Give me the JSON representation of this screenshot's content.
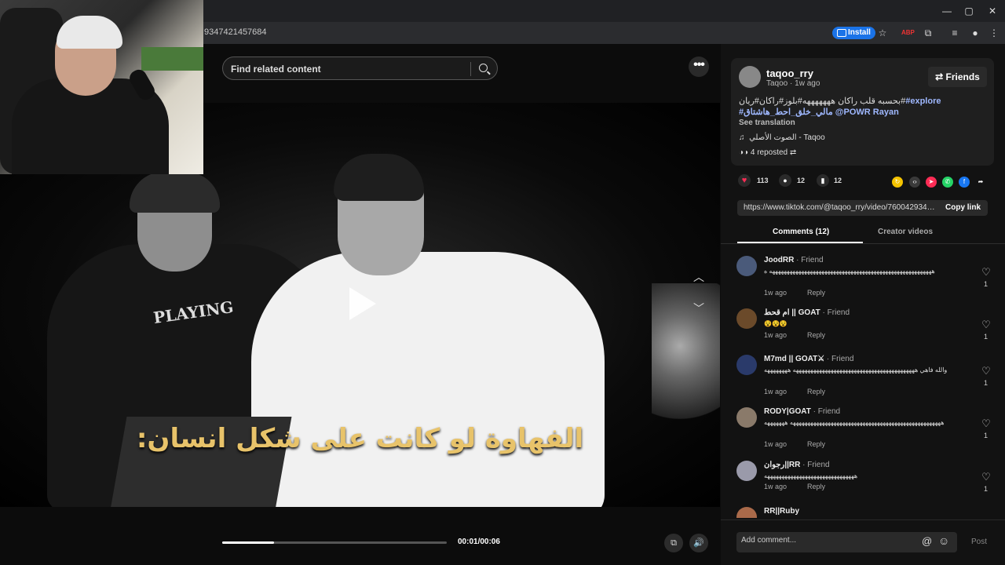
{
  "browser": {
    "url": "9347421457684",
    "install_label": "Install",
    "window_controls": [
      "—",
      "▢",
      "✕"
    ]
  },
  "search": {
    "placeholder": "Find related content"
  },
  "video": {
    "caption": "الفهاوة لو كانت على شكل انسان:",
    "shirt_text": "PLAYING",
    "time": "00:01/00:06",
    "progress_fraction": 0.23
  },
  "post": {
    "username": "taqoo_rry",
    "subline": "Taqoo · 1w ago",
    "friends_label": "Friends",
    "description_ar": "بحسبه قلب راكان هههههههه#بلوز#راكان#ريان#",
    "tag_explore": "#explore",
    "desc_line2_ar": "#مالي_خلق_احط_هاشتاق",
    "mention": "@POWR Rayan",
    "see_translation": "See translation",
    "music": "الصوت الأصلي - Taqoo",
    "reposted": "4 reposted",
    "likes": "113",
    "comments_count": "12",
    "saves": "12",
    "link": "https://www.tiktok.com/@taqoo_rry/video/7600429347...",
    "copy_link": "Copy link"
  },
  "tabs": {
    "comments": "Comments (12)",
    "creator": "Creator videos"
  },
  "comments": [
    {
      "name": "JoodRR",
      "tag": " · Friend",
      "text": "ههههههههههههههههههههههههههههههههههههههههههههههههههههههههه ه",
      "time": "1w ago",
      "reply": "Reply",
      "likes": "1"
    },
    {
      "name": "ام قحط || GOAT",
      "tag": " · Friend",
      "text": "😵😵😵",
      "time": "1w ago",
      "reply": "Reply",
      "likes": "1"
    },
    {
      "name": "M7md || GOAT⚔",
      "tag": " · Friend",
      "text": "والله فاهي ههههههههههههههههههههههههههههههههههههههههههه ههههههههه",
      "time": "1w ago",
      "reply": "Reply",
      "likes": "1"
    },
    {
      "name": "RODY|GOAT",
      "tag": " · Friend",
      "text": "ههههههههههههههههههههههههههههههههههههههههههههههههههههه هههههههه",
      "time": "1w ago",
      "reply": "Reply",
      "likes": "1"
    },
    {
      "name": "رجوان||RR",
      "tag": " · Friend",
      "text": "هههههههههههههههههههههههههههههههه",
      "time": "1w ago",
      "reply": "Reply",
      "likes": "1"
    },
    {
      "name": "RR||Ruby",
      "tag": "",
      "text": "",
      "time": "",
      "reply": "",
      "likes": ""
    }
  ],
  "add_comment": {
    "placeholder": "Add comment...",
    "post": "Post"
  }
}
